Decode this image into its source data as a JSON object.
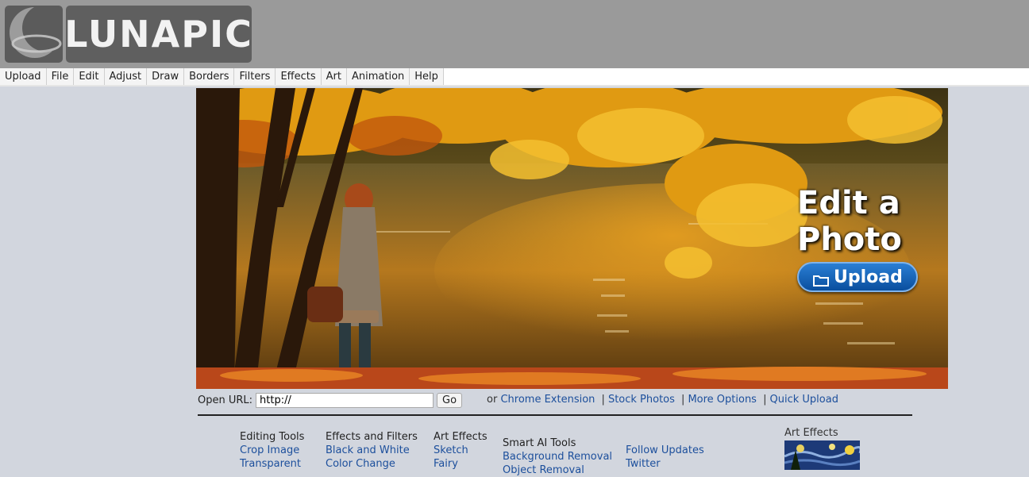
{
  "logo": {
    "text": "LUNAPIC"
  },
  "menu": [
    "Upload",
    "File",
    "Edit",
    "Adjust",
    "Draw",
    "Borders",
    "Filters",
    "Effects",
    "Art",
    "Animation",
    "Help"
  ],
  "hero": {
    "title_line1": "Edit a",
    "title_line2": "Photo",
    "upload_label": "Upload"
  },
  "open_url": {
    "label": "Open URL:",
    "value": "http://",
    "go_label": "Go"
  },
  "links": {
    "prefix": "or",
    "chrome_extension": "Chrome Extension",
    "stock_photos": "Stock Photos",
    "more_options": "More Options",
    "quick_upload": "Quick Upload",
    "separator": "|"
  },
  "columns": {
    "editing_tools": {
      "title": "Editing Tools",
      "links": [
        "Crop Image",
        "Transparent"
      ]
    },
    "effects_filters": {
      "title": "Effects and Filters",
      "links": [
        "Black and White",
        "Color Change"
      ]
    },
    "art_effects": {
      "title": "Art Effects",
      "links": [
        "Sketch",
        "Fairy"
      ]
    },
    "smart_ai": {
      "title": "Smart AI Tools",
      "links": [
        "Background Removal",
        "Object Removal"
      ]
    },
    "follow": {
      "title": "",
      "links": [
        "Follow Updates",
        "Twitter"
      ]
    }
  },
  "art_effects_panel": {
    "title": "Art Effects"
  },
  "colors": {
    "header": "#9a9a9a",
    "page": "#d2d6de",
    "link": "#1c4f9c",
    "button": "#0a4e9e"
  }
}
